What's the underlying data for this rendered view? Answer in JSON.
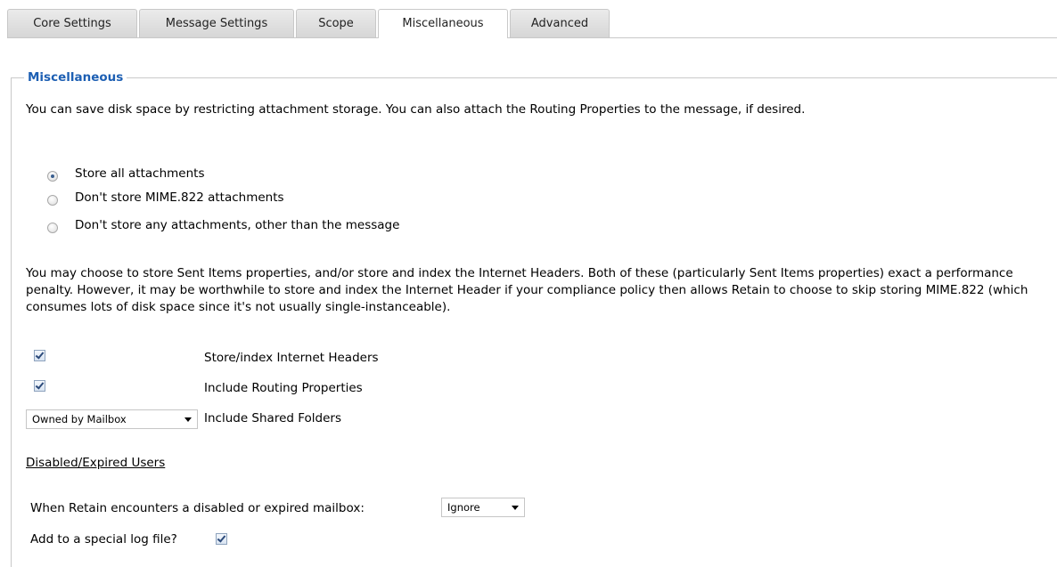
{
  "tabs": [
    {
      "label": "Core Settings",
      "active": false
    },
    {
      "label": "Message Settings",
      "active": false
    },
    {
      "label": "Scope",
      "active": false
    },
    {
      "label": "Miscellaneous",
      "active": true
    },
    {
      "label": "Advanced",
      "active": false
    }
  ],
  "fieldset": {
    "legend": "Miscellaneous"
  },
  "intro_text": "You can save disk space by restricting attachment storage. You can also attach the Routing Properties to the message, if desired.",
  "attachment_options": [
    {
      "label": "Store all attachments",
      "checked": true
    },
    {
      "label": "Don't store MIME.822 attachments",
      "checked": false
    },
    {
      "label": "Don't store any attachments, other than the message",
      "checked": false
    }
  ],
  "sent_items_text": "You may choose to store Sent Items properties, and/or store and index the Internet Headers. Both of these (particularly Sent Items properties) exact a performance penalty. However, it may be worthwhile to store and index the Internet Header if your compliance policy then allows Retain to choose to skip storing MIME.822 (which consumes lots of disk space since it's not usually single-instanceable).",
  "options": {
    "store_headers": {
      "label": "Store/index Internet Headers",
      "checked": true
    },
    "routing_properties": {
      "label": "Include Routing Properties",
      "checked": true
    },
    "shared_folders": {
      "label": "Include Shared Folders",
      "selected": "Owned by Mailbox"
    }
  },
  "disabled_users": {
    "title": "Disabled/Expired Users",
    "encounter_label": "When Retain encounters a disabled or expired mailbox:",
    "encounter_selected": "Ignore",
    "log_label": "Add to a special log file?",
    "log_checked": true
  }
}
